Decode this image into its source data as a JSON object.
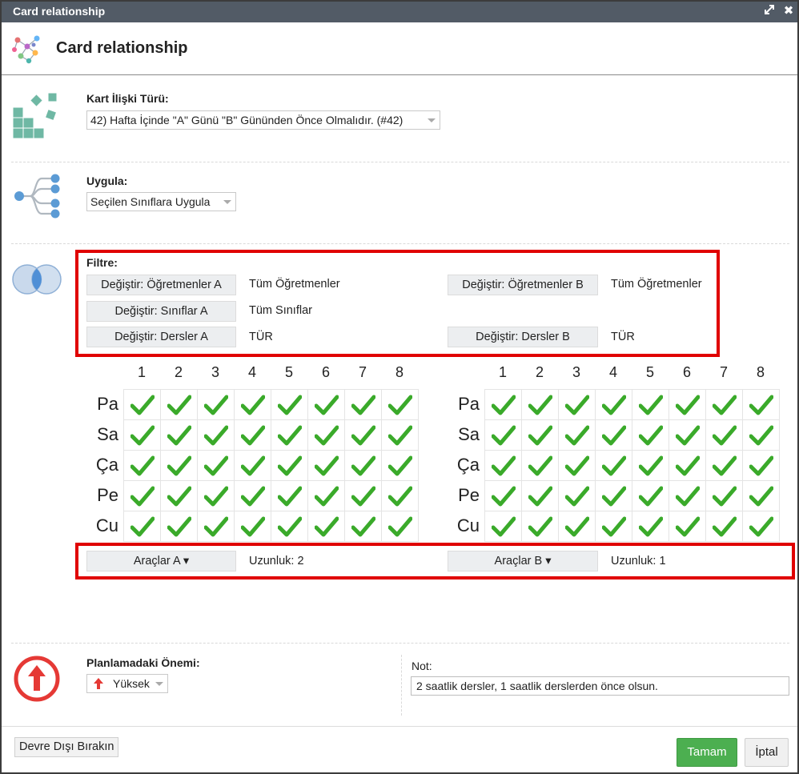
{
  "window": {
    "title": "Card relationship",
    "header_title": "Card relationship"
  },
  "relation_type": {
    "label": "Kart İlişki Türü:",
    "value": "42) Hafta İçinde \"A\" Günü \"B\" Gününden Önce Olmalıdır. (#42)"
  },
  "apply": {
    "label": "Uygula:",
    "value": "Seçilen Sınıflara Uygula"
  },
  "filter": {
    "label": "Filtre:",
    "rows": [
      {
        "button_a": "Değiştir: Öğretmenler A",
        "value_a": "Tüm Öğretmenler",
        "button_b": "Değiştir: Öğretmenler B",
        "value_b": "Tüm Öğretmenler"
      },
      {
        "button_a": "Değiştir: Sınıflar A",
        "value_a": "Tüm Sınıflar"
      },
      {
        "button_a": "Değiştir: Dersler A",
        "value_a": "TÜR",
        "button_b": "Değiştir: Dersler B",
        "value_b": "TÜR"
      }
    ]
  },
  "grid": {
    "columns": [
      "1",
      "2",
      "3",
      "4",
      "5",
      "6",
      "7",
      "8"
    ],
    "days": [
      "Pa",
      "Sa",
      "Ça",
      "Pe",
      "Cu"
    ],
    "grid_a_checked": [
      [
        true,
        true,
        true,
        true,
        true,
        true,
        true,
        true
      ],
      [
        true,
        true,
        true,
        true,
        true,
        true,
        true,
        true
      ],
      [
        true,
        true,
        true,
        true,
        true,
        true,
        true,
        true
      ],
      [
        true,
        true,
        true,
        true,
        true,
        true,
        true,
        true
      ],
      [
        true,
        true,
        true,
        true,
        true,
        true,
        true,
        true
      ]
    ],
    "grid_b_checked": [
      [
        true,
        true,
        true,
        true,
        true,
        true,
        true,
        true
      ],
      [
        true,
        true,
        true,
        true,
        true,
        true,
        true,
        true
      ],
      [
        true,
        true,
        true,
        true,
        true,
        true,
        true,
        true
      ],
      [
        true,
        true,
        true,
        true,
        true,
        true,
        true,
        true
      ],
      [
        true,
        true,
        true,
        true,
        true,
        true,
        true,
        true
      ]
    ],
    "check_color": "#3aaa2a"
  },
  "tools": {
    "tools_a_label": "Araçlar A ▾",
    "length_a": "Uzunluk: 2",
    "tools_b_label": "Araçlar B ▾",
    "length_b": "Uzunluk: 1"
  },
  "priority": {
    "label": "Planlamadaki Önemi:",
    "value": "Yüksek",
    "icon_color": "#e53935"
  },
  "note": {
    "label": "Not:",
    "value": "2 saatlik dersler, 1 saatlik derslerden önce olsun."
  },
  "footer": {
    "disable_label": "Devre Dışı Bırakın",
    "ok_label": "Tamam",
    "cancel_label": "İptal"
  },
  "colors": {
    "titlebar": "#525b66",
    "highlight_border": "#e00000",
    "ok_button": "#4caf50",
    "icon_teal": "#6fb8a4",
    "icon_blue": "#5b9bd5"
  }
}
